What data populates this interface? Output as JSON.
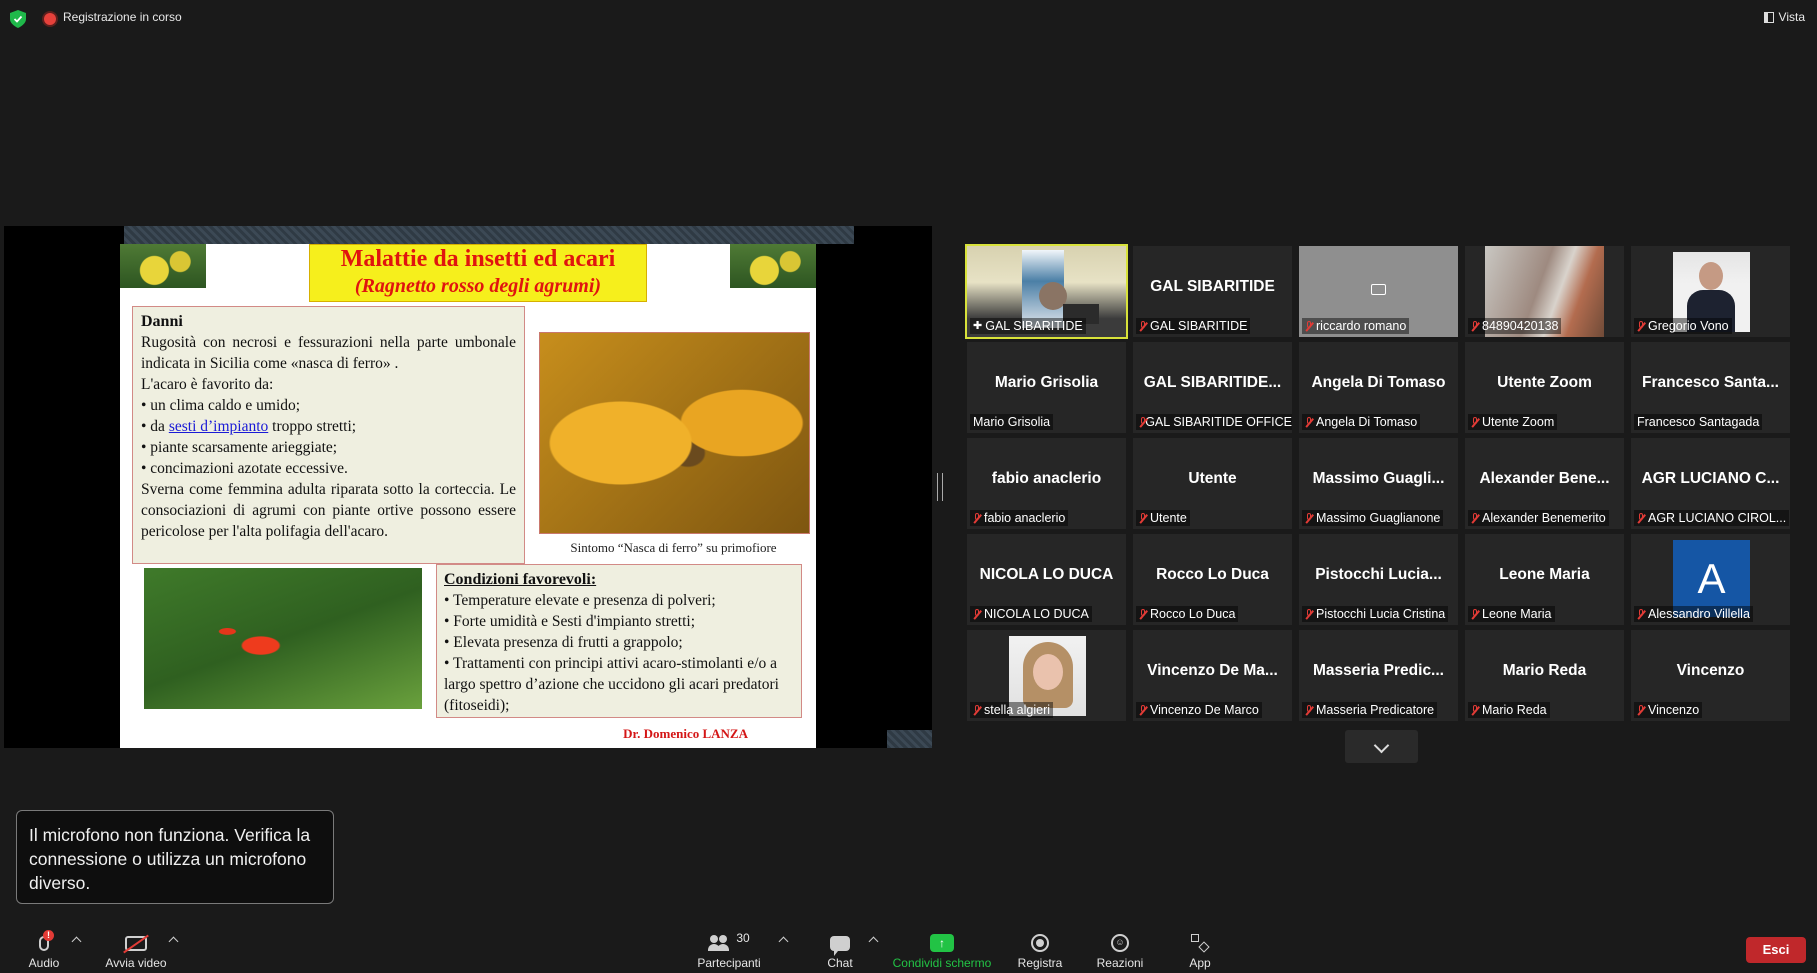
{
  "topbar": {
    "recording_label": "Registrazione in corso",
    "view_label": "Vista",
    "shield_icon": "shield-check-icon",
    "shield_color": "#1fb84a"
  },
  "slide": {
    "title_line1": "Malattie da insetti ed acari",
    "title_line2": "(Ragnetto  rosso degli agrumi)",
    "danni_heading": "Danni",
    "danni_p1": "Rugosità con necrosi e fessurazioni nella parte umbonale indicata in Sicilia come «nasca di ferro» .",
    "danni_p2": "L'acaro è favorito da:",
    "danni_b1": "•  un clima caldo e umido;",
    "danni_b2_pre": "•  da ",
    "danni_b2_link": "sesti d’impianto",
    "danni_b2_post": " troppo stretti;",
    "danni_b3": "•  piante scarsamente arieggiate;",
    "danni_b4": "•  concimazioni azotate eccessive.",
    "danni_p3": "Sverna come femmina adulta riparata sotto la corteccia. Le consociazioni di agrumi con piante ortive possono essere pericolose per l'alta polifagia dell'acaro.",
    "caption": "Sintomo “Nasca di ferro” su primofiore",
    "cond_heading": "Condizioni favorevoli:",
    "cond_b1": "•  Temperature elevate e presenza di  polveri;",
    "cond_b2": "•  Forte umidità e Sesti d'impianto stretti;",
    "cond_b3": "•  Elevata presenza di frutti a grappolo;",
    "cond_b4": "•  Trattamenti con  principi attivi acaro-stimolanti e/o a largo spettro d’azione che uccidono gli acari predatori (fitoseidi);",
    "author": "Dr. Domenico LANZA"
  },
  "participants": [
    {
      "big": "",
      "label": "GAL SIBARITIDE",
      "muted": false,
      "pinned": true,
      "media": "video-self"
    },
    {
      "big": "GAL SIBARITIDE",
      "label": "GAL SIBARITIDE",
      "muted": true,
      "media": "none"
    },
    {
      "big": "",
      "label": "riccardo romano",
      "muted": true,
      "media": "camera-off"
    },
    {
      "big": "",
      "label": "84890420138",
      "muted": true,
      "media": "photo-blur"
    },
    {
      "big": "",
      "label": "Gregorio Vono",
      "muted": true,
      "media": "photo-man"
    },
    {
      "big": "Mario Grisolia",
      "label": "Mario Grisolia",
      "muted": false,
      "media": "none"
    },
    {
      "big": "GAL SIBARITIDE...",
      "label": "GAL SIBARITIDE OFFICE",
      "muted": true,
      "media": "none"
    },
    {
      "big": "Angela Di Tomaso",
      "label": "Angela Di Tomaso",
      "muted": true,
      "media": "none"
    },
    {
      "big": "Utente Zoom",
      "label": "Utente Zoom",
      "muted": true,
      "media": "none"
    },
    {
      "big": "Francesco  Santa...",
      "label": "Francesco Santagada",
      "muted": false,
      "media": "none"
    },
    {
      "big": "fabio anaclerio",
      "label": "fabio anaclerio",
      "muted": true,
      "media": "none"
    },
    {
      "big": "Utente",
      "label": "Utente",
      "muted": true,
      "media": "none"
    },
    {
      "big": "Massimo  Guagli...",
      "label": "Massimo Guaglianone",
      "muted": true,
      "media": "none"
    },
    {
      "big": "Alexander  Bene...",
      "label": "Alexander Benemerito",
      "muted": true,
      "media": "none"
    },
    {
      "big": "AGR LUCIANO C...",
      "label": "AGR LUCIANO CIROL...",
      "muted": true,
      "media": "none"
    },
    {
      "big": "NICOLA LO DUCA",
      "label": "NICOLA LO DUCA",
      "muted": true,
      "media": "none"
    },
    {
      "big": "Rocco Lo Duca",
      "label": "Rocco Lo Duca",
      "muted": true,
      "media": "none"
    },
    {
      "big": "Pistocchi  Lucia...",
      "label": "Pistocchi Lucia Cristina",
      "muted": true,
      "media": "none"
    },
    {
      "big": "Leone Maria",
      "label": "Leone Maria",
      "muted": true,
      "media": "none"
    },
    {
      "big": "",
      "label": "Alessandro Villella",
      "muted": true,
      "media": "avatar",
      "avatar_letter": "A"
    },
    {
      "big": "",
      "label": "stella algieri",
      "muted": true,
      "media": "photo-woman"
    },
    {
      "big": "Vincenzo  De  Ma...",
      "label": "Vincenzo De Marco",
      "muted": true,
      "media": "none"
    },
    {
      "big": "Masseria  Predic...",
      "label": "Masseria Predicatore",
      "muted": true,
      "media": "none"
    },
    {
      "big": "Mario Reda",
      "label": "Mario Reda",
      "muted": true,
      "media": "none"
    },
    {
      "big": "Vincenzo",
      "label": "Vincenzo",
      "muted": true,
      "media": "none"
    }
  ],
  "notification": "Il microfono non funziona. Verifica la connessione o utilizza un microfono diverso.",
  "toolbar": {
    "audio": "Audio",
    "audio_badge": "!",
    "video": "Avvia video",
    "participants": "Partecipanti",
    "participants_count": "30",
    "chat": "Chat",
    "share": "Condividi schermo",
    "share_color": "#22c345",
    "record": "Registra",
    "reactions": "Reazioni",
    "apps": "App",
    "leave": "Esci",
    "leave_color": "#c0282b"
  }
}
